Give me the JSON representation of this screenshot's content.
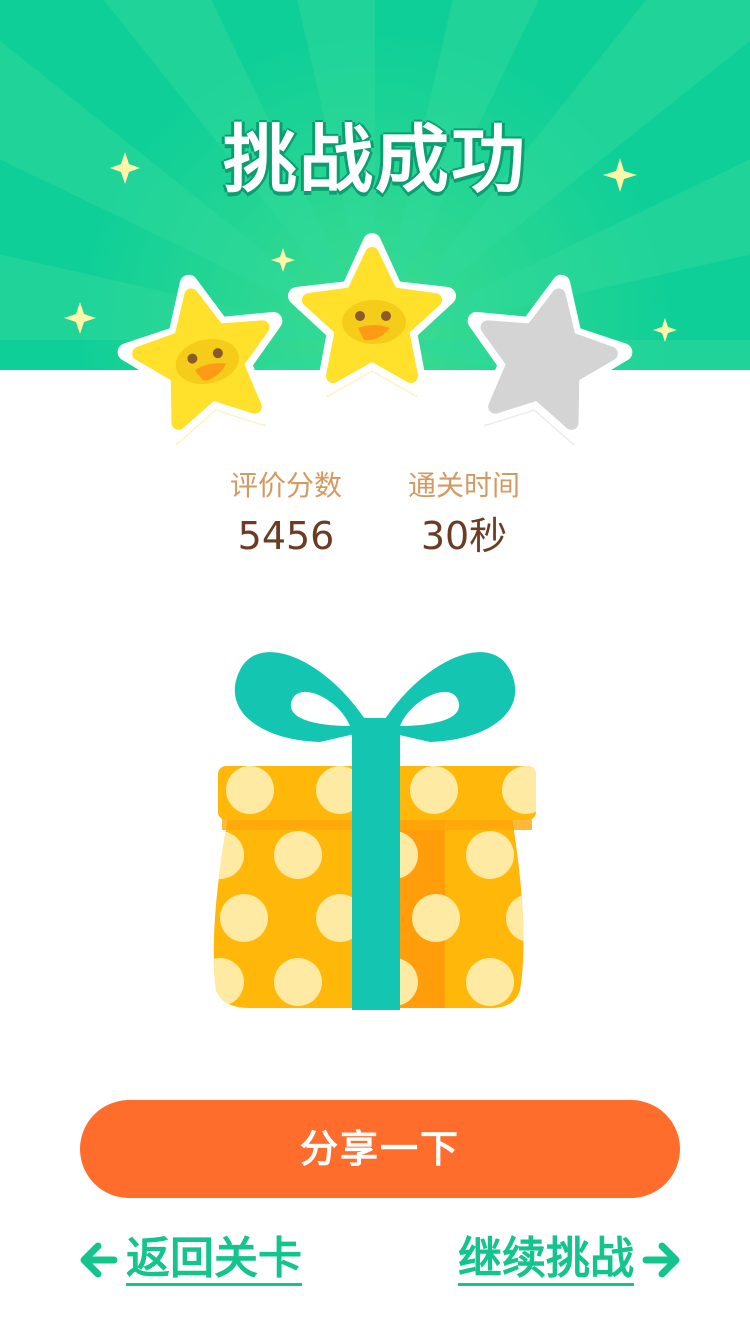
{
  "header": {
    "title": "挑战成功",
    "bg_color": "#0ecf98"
  },
  "rating": {
    "stars_earned": 2,
    "stars_total": 3
  },
  "stats": {
    "score_label": "评价分数",
    "score_value": "5456",
    "time_label": "通关时间",
    "time_value": "30秒"
  },
  "actions": {
    "share_label": "分享一下",
    "back_label": "返回关卡",
    "continue_label": "继续挑战"
  },
  "colors": {
    "primary_green": "#13c48d",
    "share_orange": "#ff6d2c",
    "label_tan": "#d39a62",
    "value_brown": "#6b3b24"
  }
}
